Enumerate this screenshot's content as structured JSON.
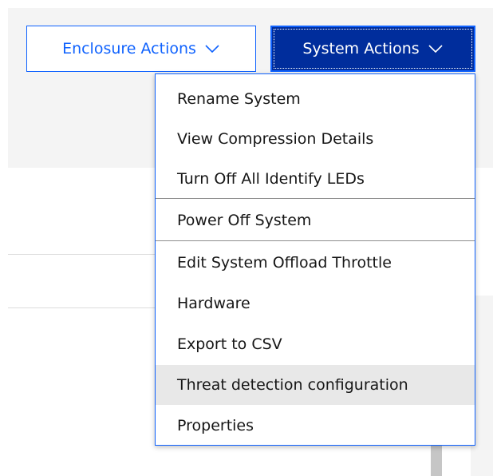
{
  "toolbar": {
    "enclosure_actions_label": "Enclosure Actions",
    "system_actions_label": "System Actions"
  },
  "menu": {
    "items": [
      {
        "label": "Rename System"
      },
      {
        "label": "View Compression Details"
      },
      {
        "label": "Turn Off All Identify LEDs"
      },
      {
        "label": "Power Off System"
      },
      {
        "label": "Edit System Offload Throttle"
      },
      {
        "label": "Hardware"
      },
      {
        "label": "Export to CSV"
      },
      {
        "label": "Threat detection configuration",
        "hovered": true
      },
      {
        "label": "Properties"
      }
    ]
  },
  "colors": {
    "accent": "#0f62fe",
    "active_button": "#002d9c",
    "hover_bg": "#e8e8e8",
    "panel_bg": "#f4f4f4"
  },
  "icons": {
    "dropdown": "chevron-down-icon"
  }
}
